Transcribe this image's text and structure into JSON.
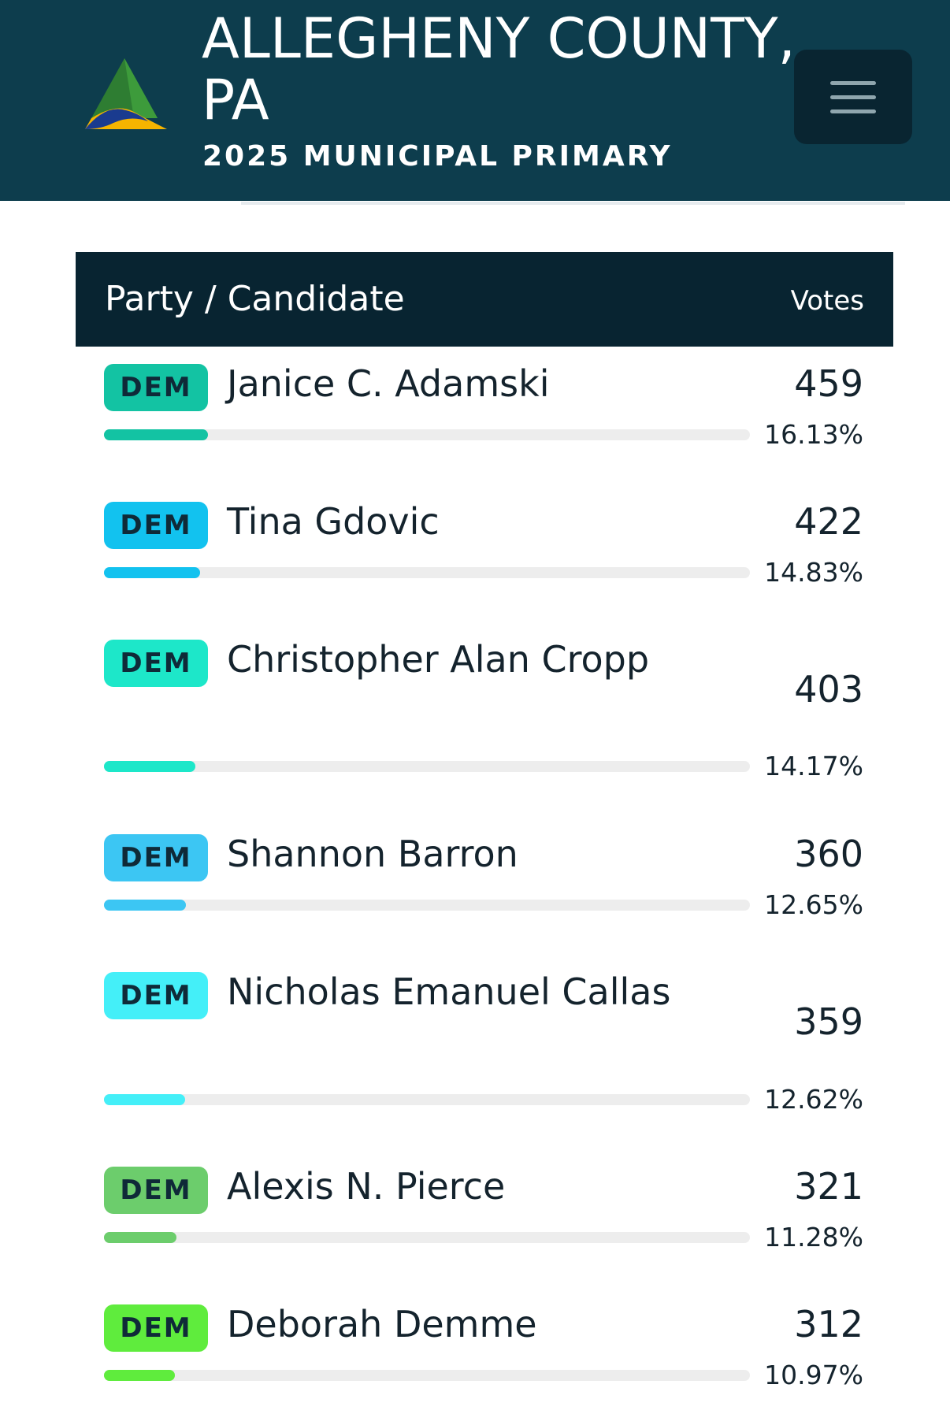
{
  "header": {
    "title": "ALLEGHENY COUNTY, PA",
    "subtitle": "2025 MUNICIPAL PRIMARY",
    "menu_icon": "hamburger-menu-icon"
  },
  "table": {
    "col_candidate": "Party / Candidate",
    "col_votes": "Votes"
  },
  "rows": [
    {
      "party": "DEM",
      "name": "Janice C. Adamski",
      "votes": "459",
      "percent": "16.13%",
      "share": 0.1613,
      "color": "#13c3a3"
    },
    {
      "party": "DEM",
      "name": "Tina Gdovic",
      "votes": "422",
      "percent": "14.83%",
      "share": 0.1483,
      "color": "#12c2ef"
    },
    {
      "party": "DEM",
      "name": "Christopher Alan Cropp",
      "votes": "403",
      "percent": "14.17%",
      "share": 0.1417,
      "color": "#1de7c9"
    },
    {
      "party": "DEM",
      "name": "Shannon Barron",
      "votes": "360",
      "percent": "12.65%",
      "share": 0.1265,
      "color": "#3cc6f3"
    },
    {
      "party": "DEM",
      "name": "Nicholas Emanuel Callas",
      "votes": "359",
      "percent": "12.62%",
      "share": 0.1262,
      "color": "#44eff8"
    },
    {
      "party": "DEM",
      "name": "Alexis N. Pierce",
      "votes": "321",
      "percent": "11.28%",
      "share": 0.1128,
      "color": "#6ccd6c"
    },
    {
      "party": "DEM",
      "name": "Deborah Demme",
      "votes": "312",
      "percent": "10.97%",
      "share": 0.1097,
      "color": "#5fec3d"
    }
  ]
}
